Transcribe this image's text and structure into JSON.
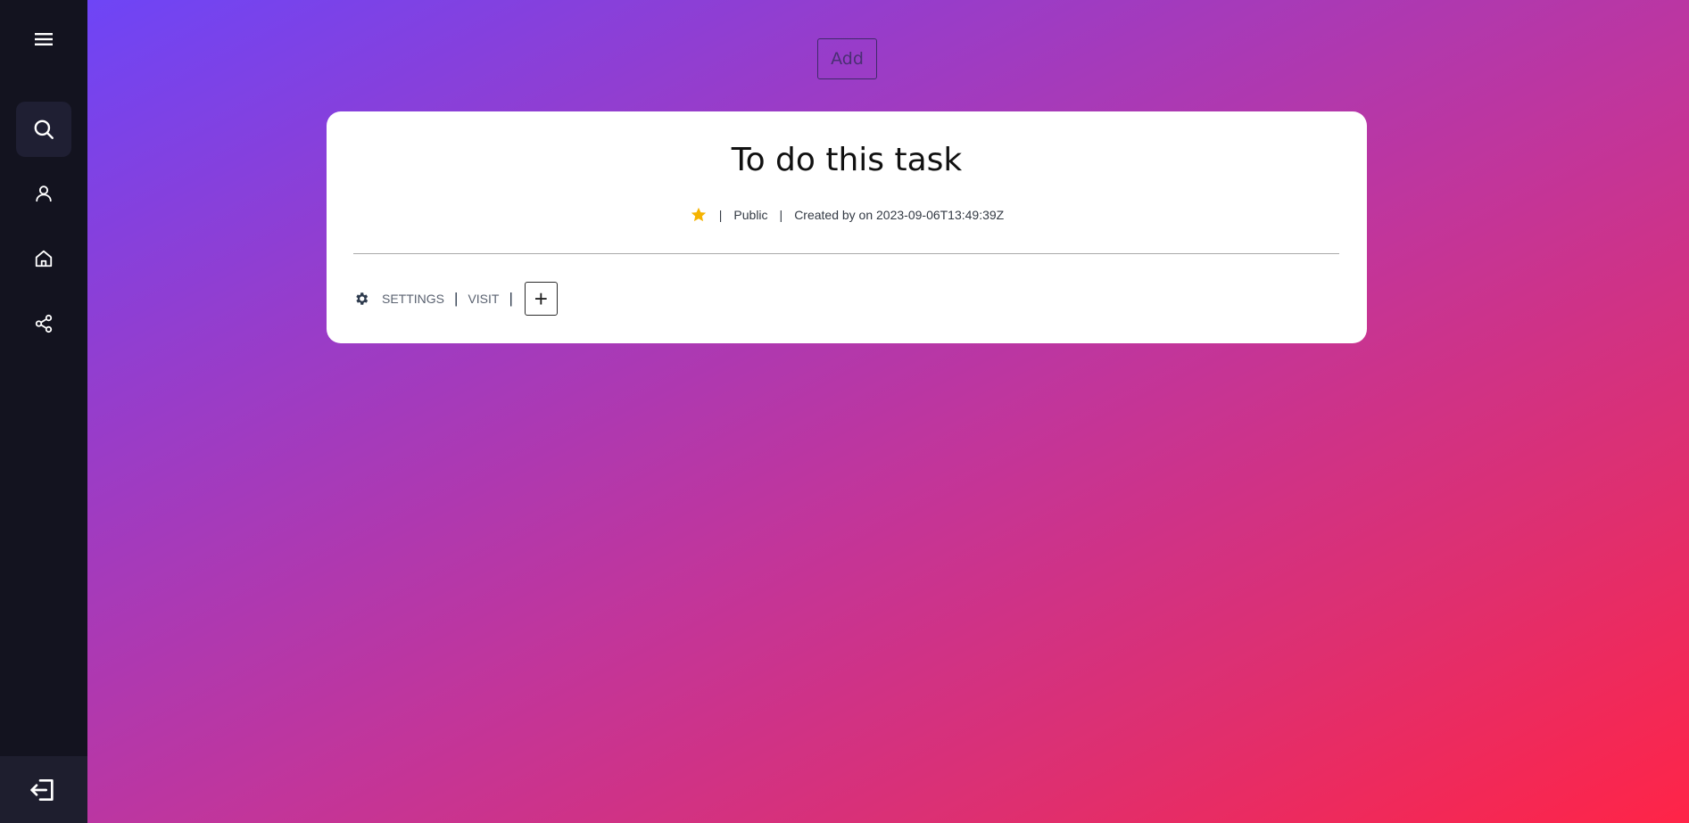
{
  "sidebar": {
    "items": [
      {
        "icon": "menu-icon"
      },
      {
        "icon": "search-icon",
        "active": true
      },
      {
        "icon": "user-icon"
      },
      {
        "icon": "home-icon"
      },
      {
        "icon": "share-icon"
      }
    ],
    "logout_icon": "logout-icon"
  },
  "toolbar": {
    "add_label": "Add"
  },
  "task": {
    "title": "To do this task",
    "visibility": "Public",
    "created_text": "Created by on 2023-09-06T13:49:39Z",
    "separator": "|",
    "actions": {
      "settings_label": "SETTINGS",
      "visit_label": "VISIT",
      "separator": "|",
      "plus_glyph": "+"
    }
  },
  "colors": {
    "sidebar_bg": "#13131f",
    "gradient_start": "#6e45f6",
    "gradient_end": "#ff2447",
    "star": "#f5b301"
  }
}
